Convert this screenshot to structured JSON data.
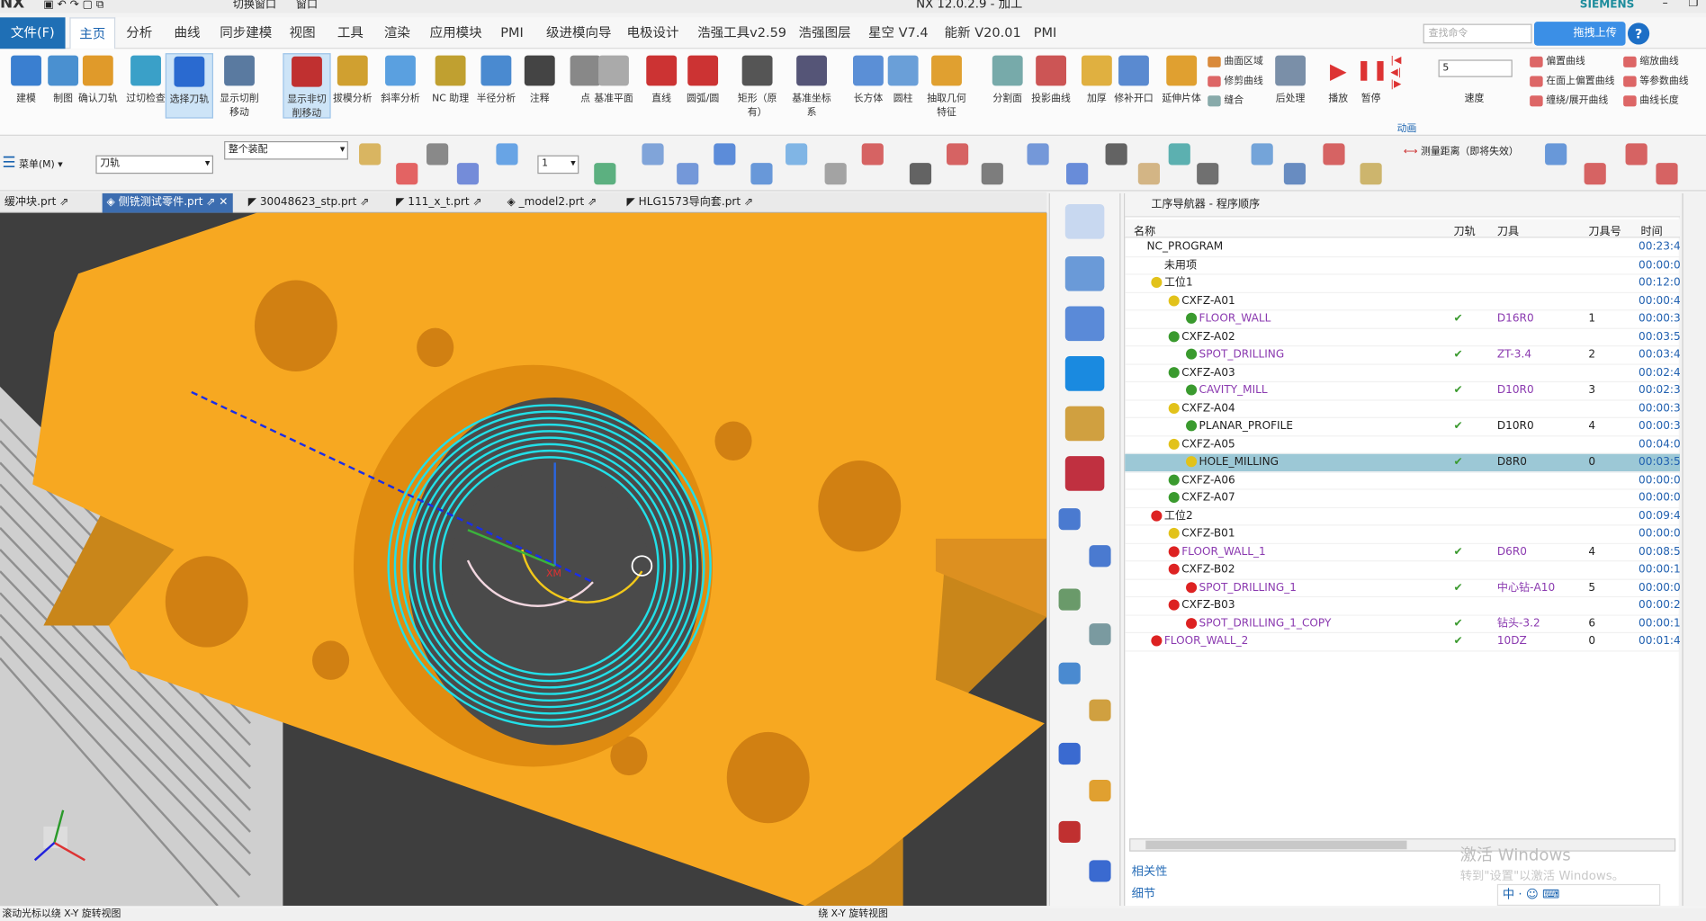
{
  "app": {
    "title": "NX 12.0.2.9 - 加工",
    "logo": "NX",
    "brand": "SIEMENS",
    "quick_switch": "切换窗口",
    "window_menu": "窗口"
  },
  "menu": {
    "file": "文件(F)",
    "tabs": [
      "主页",
      "分析",
      "曲线",
      "同步建模",
      "视图",
      "工具",
      "渲染",
      "应用模块",
      "PMI",
      "级进模向导",
      "电极设计",
      "浩强工具v2.59",
      "浩强图层",
      "星空 V7.4",
      "能新 V20.01",
      "PMI"
    ],
    "search_placeholder": "查找命令",
    "upload": "拖拽上传",
    "help": "?"
  },
  "ribbon": {
    "buttons": [
      "建模",
      "制图",
      "确认刀轨",
      "过切检查",
      "选择刀轨",
      "显示切削移动",
      "显示非切削移动",
      "拔模分析",
      "斜率分析",
      "NC 助理",
      "半径分析",
      "注释",
      "点",
      "基准平面",
      "直线",
      "圆弧/圆",
      "矩形（原有）",
      "基准坐标系",
      "长方体",
      "圆柱",
      "抽取几何特征",
      "分割面",
      "投影曲线",
      "加厚",
      "修补开口",
      "延伸片体"
    ],
    "small_col1": [
      "曲面区域",
      "修剪曲线",
      "缝合"
    ],
    "post": "后处理",
    "play": "播放",
    "pause": "暂停",
    "speed_value": "5",
    "speed_label": "速度",
    "animation": "动画",
    "small_col2": [
      "偏置曲线",
      "在面上偏置曲线",
      "缠绕/展开曲线"
    ],
    "small_col3": [
      "缩放曲线",
      "等参数曲线",
      "曲线长度"
    ]
  },
  "toolbar2": {
    "menu": "菜单(M)",
    "filter": "刀轨",
    "assembly": "整个装配",
    "layer": "1",
    "measure": "测量距离（即将失效）"
  },
  "file_tabs": [
    "缓冲块.prt",
    "侧铣测试零件.prt",
    "30048623_stp.prt",
    "111_x_t.prt",
    "_model2.prt",
    "HLG1573导向套.prt"
  ],
  "viewport": {
    "csys_label": "XM",
    "axis_z": "ZM"
  },
  "navigator": {
    "header": "工序导航器 - 程序顺序",
    "columns": [
      "名称",
      "刀轨",
      "刀具",
      "刀具号",
      "时间"
    ],
    "rows": [
      {
        "name": "NC_PROGRAM",
        "check": "",
        "tool": "",
        "num": "",
        "time": "00:23:4",
        "indent": 0,
        "state": "none",
        "purple": false
      },
      {
        "name": "未用项",
        "check": "",
        "tool": "",
        "num": "",
        "time": "00:00:0",
        "indent": 1,
        "state": "none",
        "purple": false
      },
      {
        "name": "工位1",
        "check": "",
        "tool": "",
        "num": "",
        "time": "00:12:0",
        "indent": 1,
        "state": "warn",
        "purple": false
      },
      {
        "name": "CXFZ-A01",
        "check": "",
        "tool": "",
        "num": "",
        "time": "00:00:4",
        "indent": 2,
        "state": "warn",
        "purple": false
      },
      {
        "name": "FLOOR_WALL",
        "check": "✔",
        "tool": "D16R0",
        "num": "1",
        "time": "00:00:3",
        "indent": 3,
        "state": "ok",
        "purple": true
      },
      {
        "name": "CXFZ-A02",
        "check": "",
        "tool": "",
        "num": "",
        "time": "00:03:5",
        "indent": 2,
        "state": "ok",
        "purple": false
      },
      {
        "name": "SPOT_DRILLING",
        "check": "✔",
        "tool": "ZT-3.4",
        "num": "2",
        "time": "00:03:4",
        "indent": 3,
        "state": "ok",
        "purple": true
      },
      {
        "name": "CXFZ-A03",
        "check": "",
        "tool": "",
        "num": "",
        "time": "00:02:4",
        "indent": 2,
        "state": "ok",
        "purple": false
      },
      {
        "name": "CAVITY_MILL",
        "check": "✔",
        "tool": "D10R0",
        "num": "3",
        "time": "00:02:3",
        "indent": 3,
        "state": "ok",
        "purple": true
      },
      {
        "name": "CXFZ-A04",
        "check": "",
        "tool": "",
        "num": "",
        "time": "00:00:3",
        "indent": 2,
        "state": "warn",
        "purple": false
      },
      {
        "name": "PLANAR_PROFILE",
        "check": "✔",
        "tool": "D10R0",
        "num": "4",
        "time": "00:00:3",
        "indent": 3,
        "state": "ok",
        "purple": false
      },
      {
        "name": "CXFZ-A05",
        "check": "",
        "tool": "",
        "num": "",
        "time": "00:04:0",
        "indent": 2,
        "state": "warn",
        "purple": false
      },
      {
        "name": "HOLE_MILLING",
        "check": "✔",
        "tool": "D8R0",
        "num": "0",
        "time": "00:03:5",
        "indent": 3,
        "state": "warn",
        "purple": false
      },
      {
        "name": "CXFZ-A06",
        "check": "",
        "tool": "",
        "num": "",
        "time": "00:00:0",
        "indent": 2,
        "state": "ok",
        "purple": false
      },
      {
        "name": "CXFZ-A07",
        "check": "",
        "tool": "",
        "num": "",
        "time": "00:00:0",
        "indent": 2,
        "state": "ok",
        "purple": false
      },
      {
        "name": "工位2",
        "check": "",
        "tool": "",
        "num": "",
        "time": "00:09:4",
        "indent": 1,
        "state": "no",
        "purple": false
      },
      {
        "name": "CXFZ-B01",
        "check": "",
        "tool": "",
        "num": "",
        "time": "00:00:0",
        "indent": 2,
        "state": "warn",
        "purple": false
      },
      {
        "name": "FLOOR_WALL_1",
        "check": "✔",
        "tool": "D6R0",
        "num": "4",
        "time": "00:08:5",
        "indent": 2,
        "state": "no",
        "purple": true
      },
      {
        "name": "CXFZ-B02",
        "check": "",
        "tool": "",
        "num": "",
        "time": "00:00:1",
        "indent": 2,
        "state": "no",
        "purple": false
      },
      {
        "name": "SPOT_DRILLING_1",
        "check": "✔",
        "tool": "中心钻-A10",
        "num": "5",
        "time": "00:00:0",
        "indent": 3,
        "state": "no",
        "purple": true
      },
      {
        "name": "CXFZ-B03",
        "check": "",
        "tool": "",
        "num": "",
        "time": "00:00:2",
        "indent": 2,
        "state": "no",
        "purple": false
      },
      {
        "name": "SPOT_DRILLING_1_COPY",
        "check": "✔",
        "tool": "钻头-3.2",
        "num": "6",
        "time": "00:00:1",
        "indent": 3,
        "state": "no",
        "purple": true
      },
      {
        "name": "FLOOR_WALL_2",
        "check": "✔",
        "tool": "10DZ",
        "num": "0",
        "time": "00:01:4",
        "indent": 1,
        "state": "no",
        "purple": true
      }
    ],
    "selected_index": 12,
    "section_relevance": "相关性",
    "section_details": "细节"
  },
  "status": {
    "left": "滚动光标以绕 X-Y 旋转视图",
    "center": "绕 X-Y 旋转视图"
  },
  "watermark": {
    "line1": "激活 Windows",
    "line2": "转到\"设置\"以激活 Windows。"
  },
  "ime": "中 · ☺ ⌨",
  "colors": {
    "accent": "#1f6fb5",
    "part": "#f8a81c",
    "toolpath": "#22e0e8",
    "selected_row": "#9cc8d6"
  }
}
